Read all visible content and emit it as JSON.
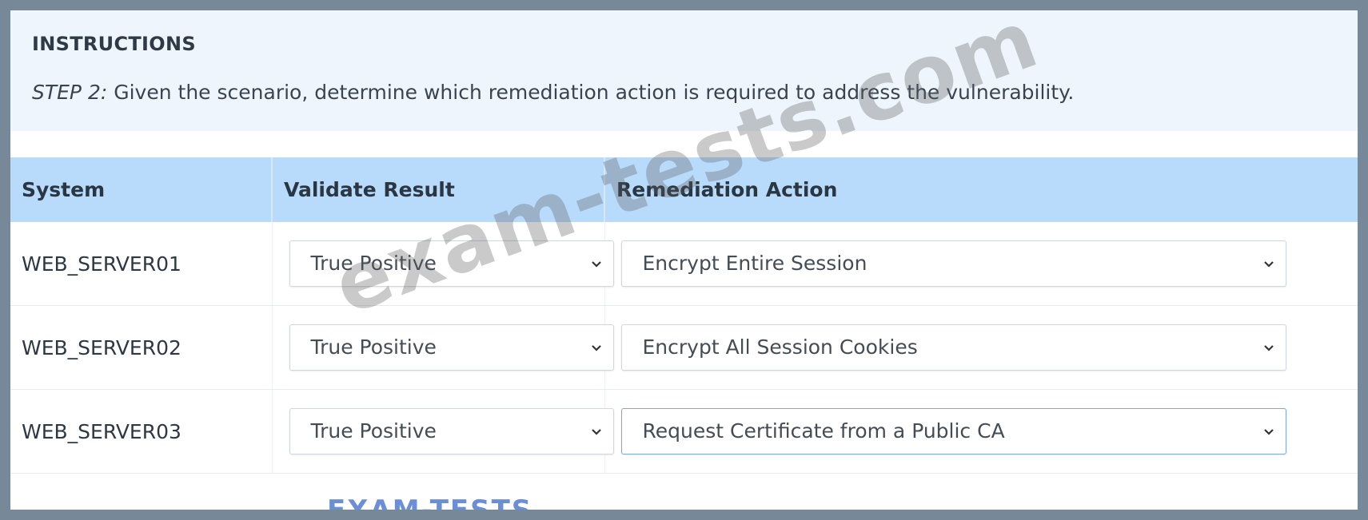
{
  "instructions": {
    "title": "INSTRUCTIONS",
    "step_label": "STEP 2:",
    "text": " Given the scenario, determine which remediation action is required to address the vulnerability."
  },
  "table": {
    "headers": [
      "System",
      "Validate Result",
      "Remediation Action"
    ],
    "rows": [
      {
        "system": "WEB_SERVER01",
        "validate_result": "True Positive",
        "remediation_action": "Encrypt Entire Session"
      },
      {
        "system": "WEB_SERVER02",
        "validate_result": "True Positive",
        "remediation_action": "Encrypt All Session Cookies"
      },
      {
        "system": "WEB_SERVER03",
        "validate_result": "True Positive",
        "remediation_action": "Request Certificate from a Public CA"
      }
    ]
  },
  "watermark": "exam-tests.com",
  "logo": "EXAM-TESTS",
  "colors": {
    "header_bg": "#b8dbfb",
    "instructions_bg": "#eef5fd",
    "frame": "#778899"
  }
}
